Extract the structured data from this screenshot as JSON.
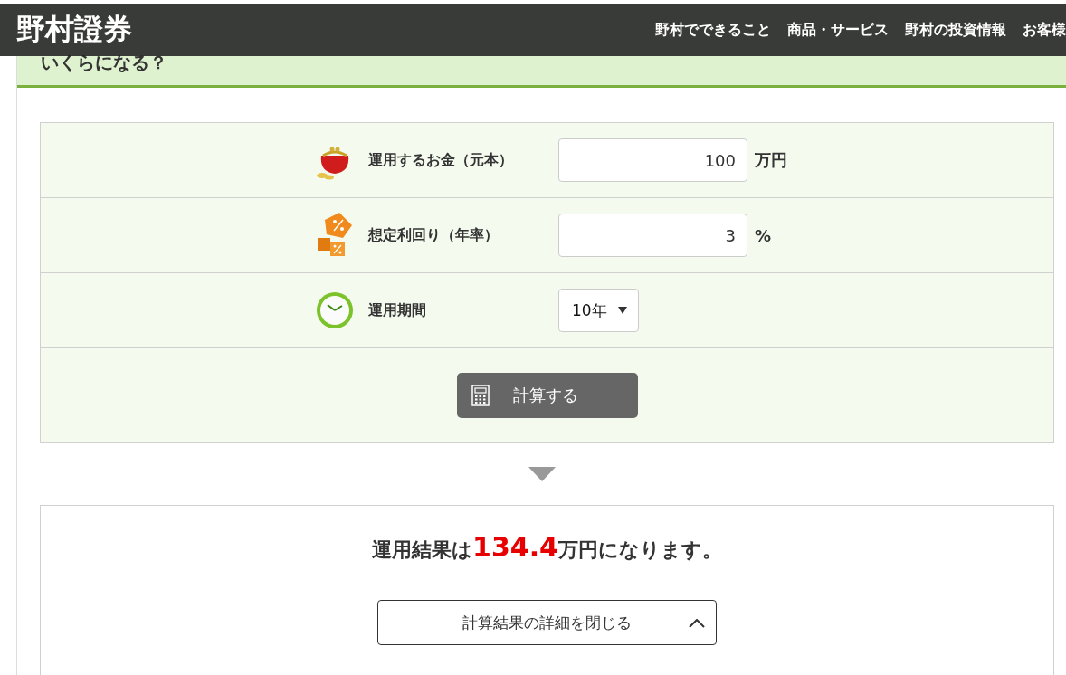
{
  "header": {
    "logo": "野村證券",
    "nav": [
      "野村でできること",
      "商品・サービス",
      "野村の投資情報",
      "お客様"
    ]
  },
  "page_title": "いくらになる？",
  "form": {
    "rows": [
      {
        "kind": "input",
        "label": "運用するお金（元本）",
        "value": "100",
        "unit": "万円"
      },
      {
        "kind": "input",
        "label": "想定利回り（年率）",
        "value": "3",
        "unit": "%"
      },
      {
        "kind": "select",
        "label": "運用期間",
        "value": "10年"
      }
    ],
    "button": "計算する"
  },
  "result": {
    "prefix": "運用結果は",
    "amount": "134.4",
    "suffix": "万円になります。",
    "details_button": "計算結果の詳細を閉じる",
    "details_expanded": true
  }
}
